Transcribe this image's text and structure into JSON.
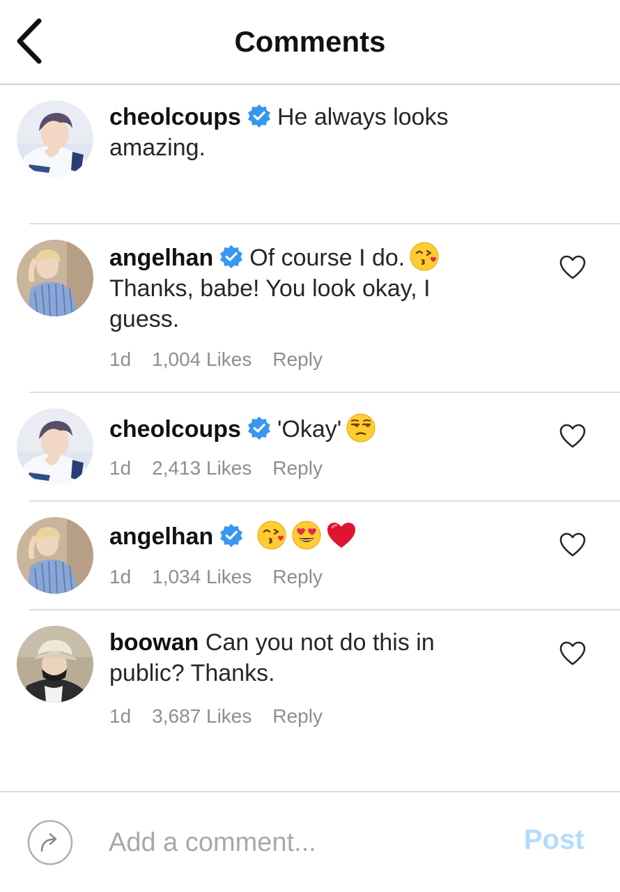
{
  "header": {
    "title": "Comments",
    "back_icon": "chevron-left-icon"
  },
  "caption": {
    "username": "cheolcoups",
    "verified": true,
    "text": "He always looks amazing."
  },
  "comments": [
    {
      "username": "angelhan",
      "verified": true,
      "text": "Of course I do.",
      "text2": "Thanks, babe! You look okay, I guess.",
      "emojis": [
        "face-blowing-kiss"
      ],
      "time": "1d",
      "likes": "1,004 Likes",
      "reply": "Reply"
    },
    {
      "username": "cheolcoups",
      "verified": true,
      "text": "'Okay'",
      "emojis": [
        "unamused-face"
      ],
      "time": "1d",
      "likes": "2,413 Likes",
      "reply": "Reply"
    },
    {
      "username": "angelhan",
      "verified": true,
      "text": "",
      "emojis": [
        "face-blowing-kiss",
        "heart-eyes-face",
        "red-heart"
      ],
      "time": "1d",
      "likes": "1,034 Likes",
      "reply": "Reply"
    },
    {
      "username": "boowan",
      "verified": false,
      "text": "Can you not do this in public? Thanks.",
      "emojis": [],
      "time": "1d",
      "likes": "3,687 Likes",
      "reply": "Reply"
    }
  ],
  "footer": {
    "placeholder": "Add a comment...",
    "post_label": "Post",
    "share_icon": "share-arrow-icon"
  },
  "colors": {
    "verified": "#3897f0",
    "post_disabled": "#b3dbff",
    "meta_text": "#8e8e8e"
  }
}
